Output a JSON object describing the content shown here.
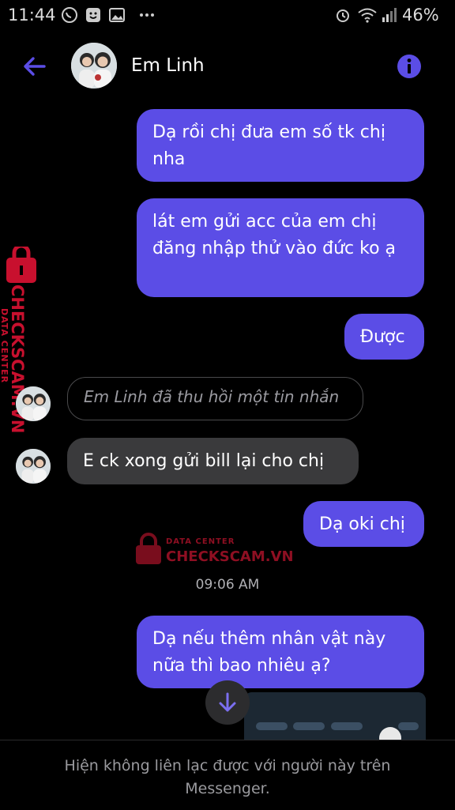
{
  "status_bar": {
    "time": "11:44",
    "battery": "46%"
  },
  "header": {
    "contact_name": "Em Linh",
    "accent": "#5b4de6"
  },
  "messages": [
    {
      "direction": "outgoing",
      "text": "Dạ rồi chị đưa em số tk chị nha"
    },
    {
      "direction": "outgoing",
      "text": "lát em gửi acc của em chị đăng nhập thử vào đức ko ạ"
    },
    {
      "direction": "outgoing",
      "text": "Được"
    },
    {
      "direction": "incoming",
      "text": "Em Linh đã thu hồi một tin nhắn"
    },
    {
      "direction": "incoming",
      "text": "E ck xong gửi bill lại cho chị"
    },
    {
      "direction": "outgoing",
      "text": "Dạ oki chị"
    },
    {
      "direction": "outgoing",
      "text": "Dạ nếu thêm nhân vật này nữa thì bao nhiêu ạ?"
    }
  ],
  "timestamp": "09:06 AM",
  "watermark": {
    "line1": "DATA CENTER",
    "line2": "CHECKSCAM.VN"
  },
  "footer": {
    "text": "Hiện không liên lạc được với người này trên Messenger."
  },
  "colors": {
    "outgoing_bubble": "#5b4de6",
    "incoming_bubble": "#3a3a3c",
    "watermark": "#c8102e"
  }
}
